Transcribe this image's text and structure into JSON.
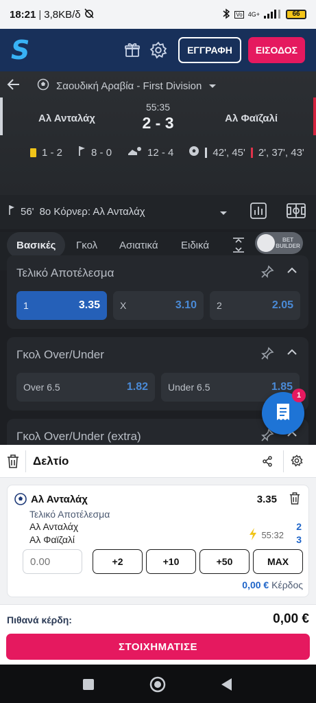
{
  "status": {
    "time": "18:21",
    "speed": "3,8KB/δ",
    "network": "4G+",
    "battery": "66"
  },
  "header": {
    "register_label": "ΕΓΓΡΑΦΗ",
    "login_label": "ΕΙΣΟΔΟΣ",
    "brand_color": "#18305a",
    "accent_color": "#e5195f"
  },
  "match": {
    "league": "Σαουδική Αραβία - First Division",
    "home": "Αλ Ανταλάχ",
    "away": "Αλ Φαϊζαλί",
    "clock": "55:35",
    "score": "2 - 3",
    "cards": "1 - 2",
    "corners": "8 - 0",
    "shots": "12 - 4",
    "home_goals": "42', 45'",
    "away_goals": "2', 37', 43'"
  },
  "event": {
    "minute": "56'",
    "text": "8ο Κόρνερ: Αλ Ανταλάχ"
  },
  "tabs": [
    {
      "label": "Βασικές"
    },
    {
      "label": "Γκολ"
    },
    {
      "label": "Ασιατικά"
    },
    {
      "label": "Ειδικά"
    }
  ],
  "bet_builder_label": "BET BUILDER",
  "markets": [
    {
      "title": "Τελικό Αποτέλεσμα",
      "odds": [
        {
          "label": "1",
          "value": "3.35",
          "selected": true
        },
        {
          "label": "X",
          "value": "3.10"
        },
        {
          "label": "2",
          "value": "2.05"
        }
      ]
    },
    {
      "title": "Γκολ Over/Under",
      "odds": [
        {
          "label": "Over 6.5",
          "value": "1.82"
        },
        {
          "label": "Under 6.5",
          "value": "1.85"
        }
      ]
    },
    {
      "title": "Γκολ Over/Under (extra)"
    }
  ],
  "fab_badge": "1",
  "slip": {
    "title": "Δελτίο",
    "bet": {
      "team": "Αλ Ανταλάχ",
      "odds": "3.35",
      "market": "Τελικό Αποτέλεσμα",
      "home": "Αλ Ανταλάχ",
      "away": "Αλ Φαϊζαλί",
      "time": "55:32",
      "home_score": "2",
      "away_score": "3"
    },
    "stake_placeholder": "0.00",
    "quick": [
      "+2",
      "+10",
      "+50",
      "MAX"
    ],
    "gain_value": "0,00 €",
    "gain_label": "Κέρδος"
  },
  "summary": {
    "label": "Πιθανά κέρδη:",
    "value": "0,00 €",
    "place_label": "ΣΤΟΙΧΗΜΑΤΙΣΕ"
  }
}
